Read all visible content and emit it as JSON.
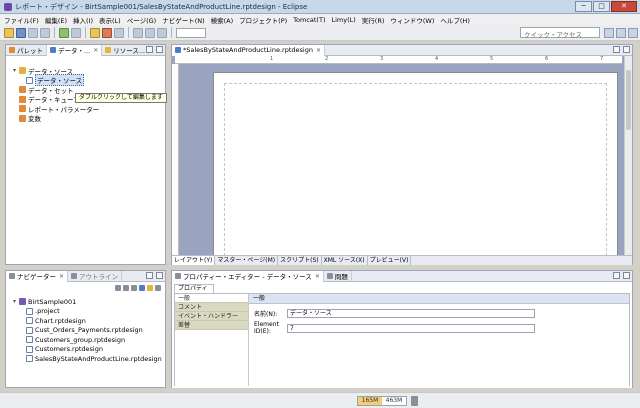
{
  "window": {
    "title": "レポート・デザイン - BirtSample001/SalesByStateAndProductLine.rptdesign - Eclipse",
    "minimize": "─",
    "maximize": "□",
    "close": "✕"
  },
  "menu": [
    "ファイル(F)",
    "編集(E)",
    "挿入(I)",
    "表示(L)",
    "ページ(G)",
    "ナビゲート(N)",
    "検索(A)",
    "プロジェクト(P)",
    "Tomcat(T)",
    "Limy(L)",
    "実行(R)",
    "ウィンドウ(W)",
    "ヘルプ(H)"
  ],
  "toolbar": {
    "quick_access_placeholder": "クイック・アクセス"
  },
  "left_top_panel": {
    "tabs": [
      {
        "label": "パレット"
      },
      {
        "label": "データ・..."
      },
      {
        "label": "リソース..."
      }
    ],
    "tree": {
      "root": "データ・ソース",
      "selected": "データ・ソース",
      "items": [
        "データ・セット",
        "データ・キューブ",
        "レポート・パラメーター",
        "変数"
      ]
    },
    "tooltip": "ダブルクリックして編集します"
  },
  "editor": {
    "tab_label": "*SalesByStateAndProductLine.rptdesign",
    "ruler_marks": [
      "1",
      "2",
      "3",
      "4",
      "5",
      "6",
      "7"
    ],
    "bottom_tabs": [
      "レイアウト(Y)",
      "マスター・ページ(M)",
      "スクリプト(S)",
      "XML ソース(X)",
      "プレビュー(V)"
    ]
  },
  "navigator": {
    "tabs": [
      {
        "label": "ナビゲーター"
      },
      {
        "label": "アウトライン"
      }
    ],
    "project": "BirtSample001",
    "files": [
      ".project",
      "Chart.rptdesign",
      "Cust_Orders_Payments.rptdesign",
      "Customers_group.rptdesign",
      "Customers.rptdesign",
      "SalesByStateAndProductLine.rptdesign"
    ]
  },
  "properties": {
    "tabs": [
      {
        "label": "プロパティー・エディター - データ・ソース"
      },
      {
        "label": "問題"
      }
    ],
    "subtab": "プロパティー",
    "nav": [
      "一般",
      "コメント",
      "イベント・ハンドラー",
      "差替"
    ],
    "section_header": "一般",
    "name_label": "名前(N):",
    "name_value": "データ・ソース",
    "element_id_label": "Element ID(E):",
    "element_id_value": "7"
  },
  "status": {
    "heap_used": "165M",
    "heap_total": "463M"
  }
}
